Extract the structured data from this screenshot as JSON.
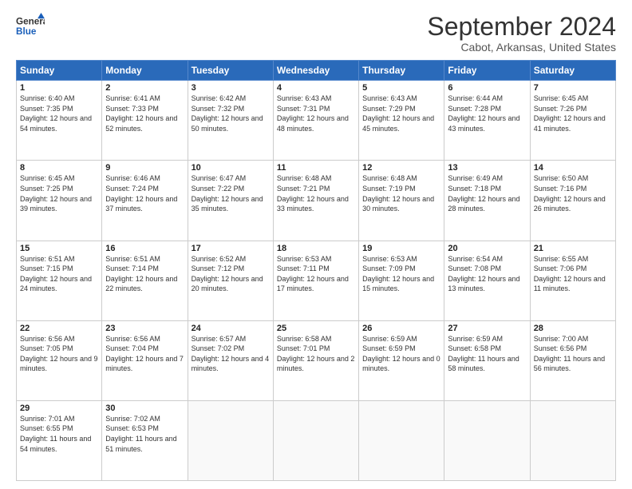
{
  "logo": {
    "line1": "General",
    "line2": "Blue"
  },
  "title": "September 2024",
  "subtitle": "Cabot, Arkansas, United States",
  "days_of_week": [
    "Sunday",
    "Monday",
    "Tuesday",
    "Wednesday",
    "Thursday",
    "Friday",
    "Saturday"
  ],
  "weeks": [
    [
      {
        "day": 1,
        "sunrise": "6:40 AM",
        "sunset": "7:35 PM",
        "daylight": "12 hours and 54 minutes."
      },
      {
        "day": 2,
        "sunrise": "6:41 AM",
        "sunset": "7:33 PM",
        "daylight": "12 hours and 52 minutes."
      },
      {
        "day": 3,
        "sunrise": "6:42 AM",
        "sunset": "7:32 PM",
        "daylight": "12 hours and 50 minutes."
      },
      {
        "day": 4,
        "sunrise": "6:43 AM",
        "sunset": "7:31 PM",
        "daylight": "12 hours and 48 minutes."
      },
      {
        "day": 5,
        "sunrise": "6:43 AM",
        "sunset": "7:29 PM",
        "daylight": "12 hours and 45 minutes."
      },
      {
        "day": 6,
        "sunrise": "6:44 AM",
        "sunset": "7:28 PM",
        "daylight": "12 hours and 43 minutes."
      },
      {
        "day": 7,
        "sunrise": "6:45 AM",
        "sunset": "7:26 PM",
        "daylight": "12 hours and 41 minutes."
      }
    ],
    [
      {
        "day": 8,
        "sunrise": "6:45 AM",
        "sunset": "7:25 PM",
        "daylight": "12 hours and 39 minutes."
      },
      {
        "day": 9,
        "sunrise": "6:46 AM",
        "sunset": "7:24 PM",
        "daylight": "12 hours and 37 minutes."
      },
      {
        "day": 10,
        "sunrise": "6:47 AM",
        "sunset": "7:22 PM",
        "daylight": "12 hours and 35 minutes."
      },
      {
        "day": 11,
        "sunrise": "6:48 AM",
        "sunset": "7:21 PM",
        "daylight": "12 hours and 33 minutes."
      },
      {
        "day": 12,
        "sunrise": "6:48 AM",
        "sunset": "7:19 PM",
        "daylight": "12 hours and 30 minutes."
      },
      {
        "day": 13,
        "sunrise": "6:49 AM",
        "sunset": "7:18 PM",
        "daylight": "12 hours and 28 minutes."
      },
      {
        "day": 14,
        "sunrise": "6:50 AM",
        "sunset": "7:16 PM",
        "daylight": "12 hours and 26 minutes."
      }
    ],
    [
      {
        "day": 15,
        "sunrise": "6:51 AM",
        "sunset": "7:15 PM",
        "daylight": "12 hours and 24 minutes."
      },
      {
        "day": 16,
        "sunrise": "6:51 AM",
        "sunset": "7:14 PM",
        "daylight": "12 hours and 22 minutes."
      },
      {
        "day": 17,
        "sunrise": "6:52 AM",
        "sunset": "7:12 PM",
        "daylight": "12 hours and 20 minutes."
      },
      {
        "day": 18,
        "sunrise": "6:53 AM",
        "sunset": "7:11 PM",
        "daylight": "12 hours and 17 minutes."
      },
      {
        "day": 19,
        "sunrise": "6:53 AM",
        "sunset": "7:09 PM",
        "daylight": "12 hours and 15 minutes."
      },
      {
        "day": 20,
        "sunrise": "6:54 AM",
        "sunset": "7:08 PM",
        "daylight": "12 hours and 13 minutes."
      },
      {
        "day": 21,
        "sunrise": "6:55 AM",
        "sunset": "7:06 PM",
        "daylight": "12 hours and 11 minutes."
      }
    ],
    [
      {
        "day": 22,
        "sunrise": "6:56 AM",
        "sunset": "7:05 PM",
        "daylight": "12 hours and 9 minutes."
      },
      {
        "day": 23,
        "sunrise": "6:56 AM",
        "sunset": "7:04 PM",
        "daylight": "12 hours and 7 minutes."
      },
      {
        "day": 24,
        "sunrise": "6:57 AM",
        "sunset": "7:02 PM",
        "daylight": "12 hours and 4 minutes."
      },
      {
        "day": 25,
        "sunrise": "6:58 AM",
        "sunset": "7:01 PM",
        "daylight": "12 hours and 2 minutes."
      },
      {
        "day": 26,
        "sunrise": "6:59 AM",
        "sunset": "6:59 PM",
        "daylight": "12 hours and 0 minutes."
      },
      {
        "day": 27,
        "sunrise": "6:59 AM",
        "sunset": "6:58 PM",
        "daylight": "11 hours and 58 minutes."
      },
      {
        "day": 28,
        "sunrise": "7:00 AM",
        "sunset": "6:56 PM",
        "daylight": "11 hours and 56 minutes."
      }
    ],
    [
      {
        "day": 29,
        "sunrise": "7:01 AM",
        "sunset": "6:55 PM",
        "daylight": "11 hours and 54 minutes."
      },
      {
        "day": 30,
        "sunrise": "7:02 AM",
        "sunset": "6:53 PM",
        "daylight": "11 hours and 51 minutes."
      },
      null,
      null,
      null,
      null,
      null
    ]
  ],
  "labels": {
    "sunrise": "Sunrise:",
    "sunset": "Sunset:",
    "daylight": "Daylight:"
  }
}
